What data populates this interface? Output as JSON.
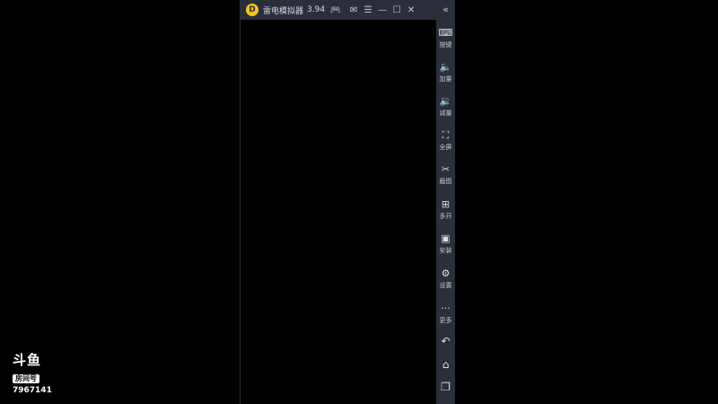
{
  "window": {
    "title": "雷电模拟器",
    "version": "3.94"
  },
  "titlebar_icons": [
    "gamepad-icon",
    "mail-icon",
    "menu-icon",
    "minimize-icon",
    "maximize-icon",
    "close-icon"
  ],
  "sidebar": {
    "collapse_glyph": "«",
    "buttons": [
      {
        "icon": "keyboard-icon",
        "glyph": "⌨",
        "label": "按键"
      },
      {
        "icon": "volume-up-icon",
        "glyph": "🔈",
        "label": "加量"
      },
      {
        "icon": "volume-down-icon",
        "glyph": "🔉",
        "label": "减量"
      },
      {
        "icon": "fullscreen-icon",
        "glyph": "⛶",
        "label": "全屏"
      },
      {
        "icon": "scissors-icon",
        "glyph": "✂",
        "label": "截图"
      },
      {
        "icon": "multi-instance-icon",
        "glyph": "⊞",
        "label": "多开"
      },
      {
        "icon": "install-apk-icon",
        "glyph": "▣",
        "label": "安装"
      },
      {
        "icon": "settings-gear-icon",
        "glyph": "⚙",
        "label": "设置"
      },
      {
        "icon": "more-dots-icon",
        "glyph": "···",
        "label": "更多"
      }
    ],
    "nav": [
      {
        "icon": "back-icon",
        "glyph": "↶"
      },
      {
        "icon": "home-icon",
        "glyph": "⌂"
      },
      {
        "icon": "recent-apps-icon",
        "glyph": "❐"
      }
    ]
  },
  "watermark": {
    "logo": "斗鱼",
    "badge": "房间号",
    "room_id": "7967141"
  }
}
